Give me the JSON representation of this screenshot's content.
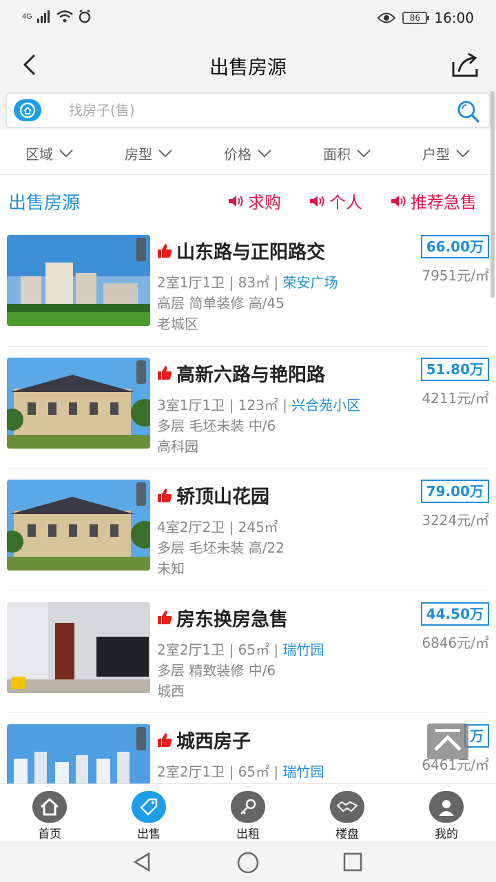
{
  "status_bar": {
    "network": "4G",
    "battery": "86",
    "time": "16:00"
  },
  "header": {
    "title": "出售房源"
  },
  "search": {
    "placeholder": "找房子(售)"
  },
  "filters": [
    "区域",
    "房型",
    "价格",
    "面积",
    "户型"
  ],
  "section": {
    "title": "出售房源",
    "tags": [
      "求购",
      "个人",
      "推荐急售"
    ]
  },
  "listings": [
    {
      "title": "山东路与正阳路交",
      "layout": "2室1厅1卫 | 83㎡ | ",
      "community": "荣安广场",
      "detail": "高层 简单装修 高/45",
      "district": "老城区",
      "price": "66.00万",
      "unit_price": "7951元/㎡"
    },
    {
      "title": "高新六路与艳阳路",
      "layout": "3室1厅1卫 | 123㎡ | ",
      "community": "兴合苑小区",
      "detail": "多层 毛坯未装 中/6",
      "district": "高科园",
      "price": "51.80万",
      "unit_price": "4211元/㎡"
    },
    {
      "title": "轿顶山花园",
      "layout": "4室2厅2卫 | 245㎡",
      "community": "",
      "detail": "多层 毛坯未装 高/22",
      "district": "未知",
      "price": "79.00万",
      "unit_price": "3224元/㎡"
    },
    {
      "title": "房东换房急售",
      "layout": "2室2厅1卫 | 65㎡ | ",
      "community": "瑞竹园",
      "detail": "多层 精致装修 中/6",
      "district": "城西",
      "price": "44.50万",
      "unit_price": "6846元/㎡"
    },
    {
      "title": "城西房子",
      "layout": "2室2厅1卫 | 65㎡ | ",
      "community": "瑞竹园",
      "detail": "",
      "district": "",
      "price": "万",
      "unit_price": "6461元/㎡"
    }
  ],
  "bottom_nav": [
    "首页",
    "出售",
    "出租",
    "楼盘",
    "我的"
  ],
  "colors": {
    "accent": "#1e8fd8",
    "tag": "#e0144c",
    "thumb_up": "#e61e1e"
  }
}
